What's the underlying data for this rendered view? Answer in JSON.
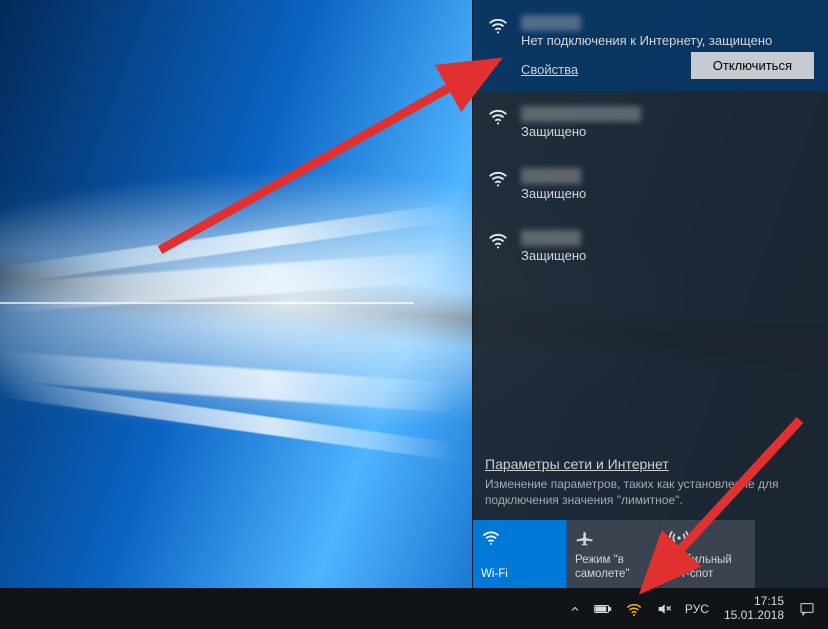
{
  "current_network": {
    "status": "Нет подключения к Интернету, защищено",
    "properties_label": "Свойства",
    "disconnect_label": "Отключиться"
  },
  "other_networks": [
    {
      "status": "Защищено"
    },
    {
      "status": "Защищено"
    },
    {
      "status": "Защищено"
    }
  ],
  "params": {
    "link": "Параметры сети и Интернет",
    "desc": "Изменение параметров, таких как установление для подключения значения \"лимитное\"."
  },
  "tiles": {
    "wifi": "Wi-Fi",
    "airplane": "Режим \"в самолете\"",
    "hotspot": "Мобильный хот-спот"
  },
  "tray": {
    "language": "РУС",
    "time": "17:15",
    "date": "15.01.2018"
  }
}
